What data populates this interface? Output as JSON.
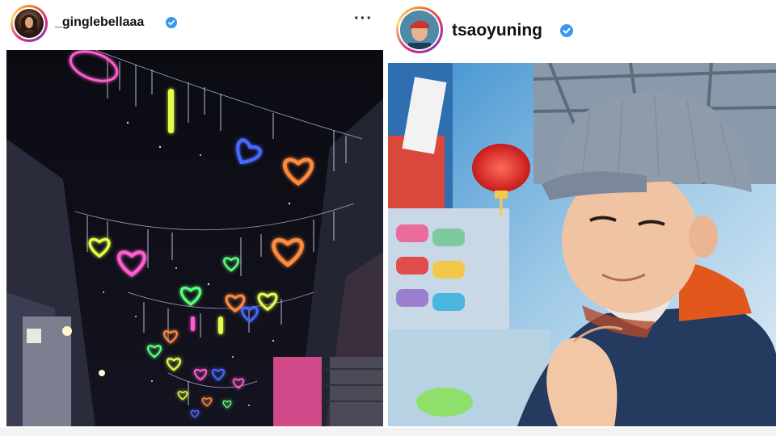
{
  "posts": [
    {
      "username": "_ginglebellaaa",
      "verified": true,
      "more_icon": "three-dots-icon",
      "photo": {
        "subject": "neon-heart-lights-alley-night"
      }
    },
    {
      "username": "tsaoyuning",
      "verified": true,
      "photo": {
        "subject": "man-in-cap-market-selfie"
      }
    }
  ],
  "colors": {
    "verified_badge": "#3897f0",
    "neon_pink": "#ff5ccf",
    "neon_orange": "#ff8a3d",
    "neon_blue": "#4a6bff",
    "neon_green": "#5cff7a",
    "neon_yellow": "#e8ff4a",
    "cap_grey": "#8e9bab",
    "jacket_navy": "#243a5e",
    "hood_orange": "#e2571b"
  }
}
